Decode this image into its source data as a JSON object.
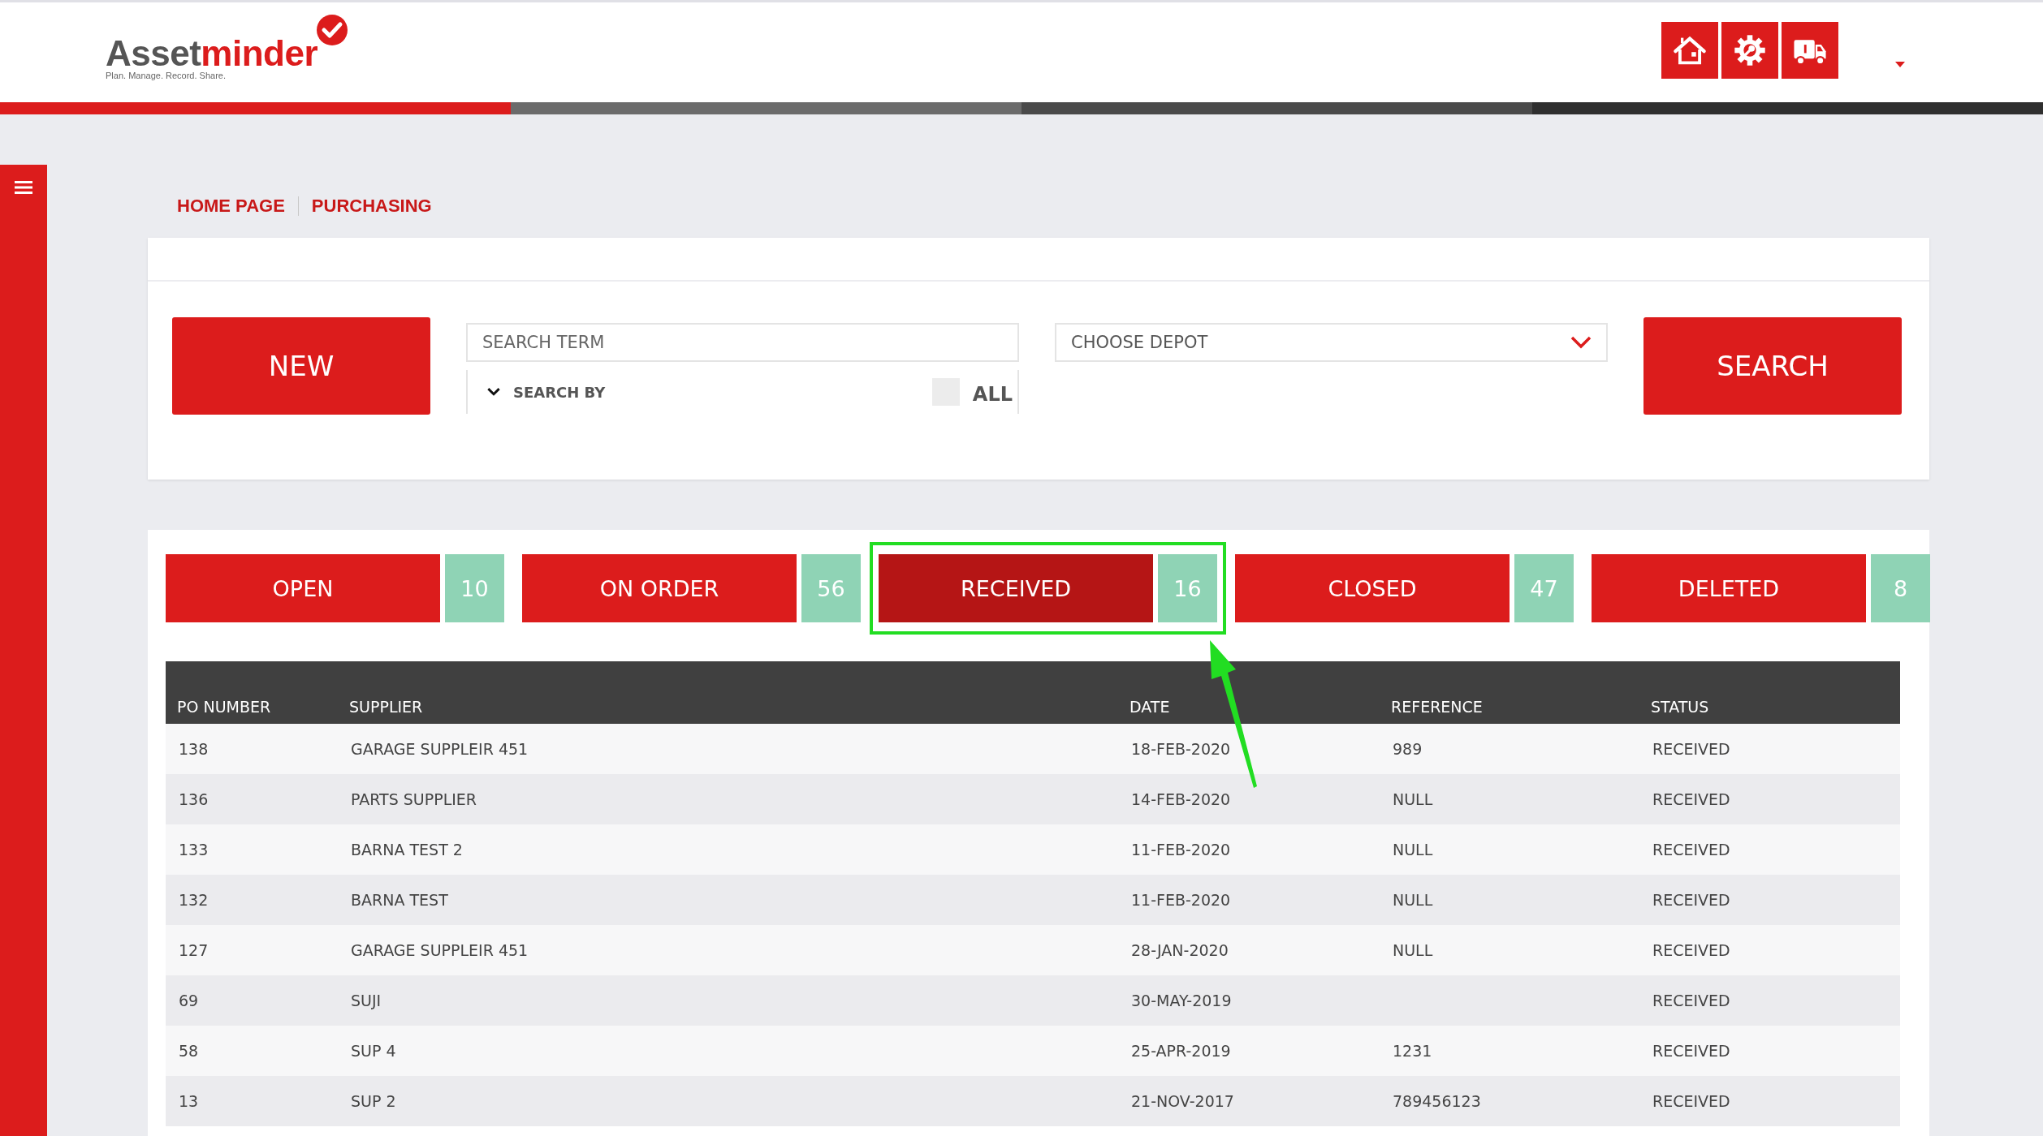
{
  "logo": {
    "name_start": "Asset",
    "name_end": "minder",
    "tagline": "Plan. Manage. Record. Share."
  },
  "breadcrumb": [
    "HOME PAGE",
    "PURCHASING"
  ],
  "search": {
    "new_button": "NEW",
    "placeholder": "SEARCH TERM",
    "search_by": "SEARCH BY",
    "all_label": "ALL",
    "all_checked": false,
    "depot_placeholder": "CHOOSE DEPOT",
    "search_button": "SEARCH"
  },
  "status_tabs": [
    {
      "label": "OPEN",
      "count": "10",
      "selected": false
    },
    {
      "label": "ON ORDER",
      "count": "56",
      "selected": false
    },
    {
      "label": "RECEIVED",
      "count": "16",
      "selected": true
    },
    {
      "label": "CLOSED",
      "count": "47",
      "selected": false
    },
    {
      "label": "DELETED",
      "count": "8",
      "selected": false
    }
  ],
  "table": {
    "columns": [
      "PO NUMBER",
      "SUPPLIER",
      "DATE",
      "REFERENCE",
      "STATUS"
    ],
    "rows": [
      [
        "138",
        "GARAGE SUPPLEIR 451",
        "18-FEB-2020",
        "989",
        "RECEIVED"
      ],
      [
        "136",
        "PARTS SUPPLIER",
        "14-FEB-2020",
        "NULL",
        "RECEIVED"
      ],
      [
        "133",
        "BARNA TEST 2",
        "11-FEB-2020",
        "NULL",
        "RECEIVED"
      ],
      [
        "132",
        "BARNA TEST",
        "11-FEB-2020",
        "NULL",
        "RECEIVED"
      ],
      [
        "127",
        "GARAGE SUPPLEIR 451",
        "28-JAN-2020",
        "NULL",
        "RECEIVED"
      ],
      [
        "69",
        "SUJI",
        "30-MAY-2019",
        "",
        "RECEIVED"
      ],
      [
        "58",
        "SUP 4",
        "25-APR-2019",
        "1231",
        "RECEIVED"
      ],
      [
        "13",
        "SUP 2",
        "21-NOV-2017",
        "789456123",
        "RECEIVED"
      ]
    ]
  }
}
